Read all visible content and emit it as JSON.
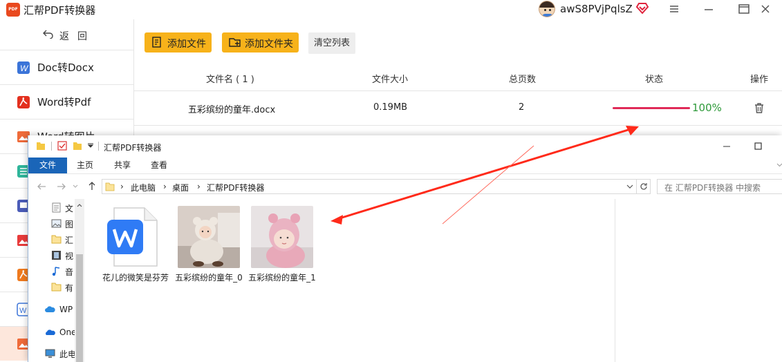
{
  "app": {
    "title": "汇帮PDF转换器",
    "logo_text": "PDF",
    "username": "awS8PVjPqlsZ",
    "accent_color": "#f7b21a",
    "progress_color": "#e02a58",
    "status_color": "#2e9a3a"
  },
  "sidebar": {
    "back_label": "返回",
    "items": [
      {
        "label": "Doc转Docx",
        "icon": "word-icon"
      },
      {
        "label": "Word转Pdf",
        "icon": "pdf-icon"
      },
      {
        "label": "Word转图片",
        "icon": "image-icon"
      },
      {
        "label": "",
        "icon": "excel-icon"
      },
      {
        "label": "",
        "icon": "ppt-icon"
      },
      {
        "label": "",
        "icon": "image-icon"
      },
      {
        "label": "",
        "icon": "pdf-icon"
      },
      {
        "label": "",
        "icon": "word-icon"
      },
      {
        "label": "",
        "icon": "image-icon"
      }
    ]
  },
  "toolbar": {
    "add_file": "添加文件",
    "add_folder": "添加文件夹",
    "clear_list": "清空列表"
  },
  "table": {
    "headers": {
      "name": "文件名 ( 1 )",
      "size": "文件大小",
      "pages": "总页数",
      "status": "状态",
      "action": "操作"
    },
    "rows": [
      {
        "name": "五彩缤纷的童年.docx",
        "size": "0.19MB",
        "pages": "2",
        "progress": 1.0,
        "status": "100%"
      }
    ]
  },
  "explorer": {
    "title": "汇帮PDF转换器",
    "ribbon_tabs": [
      "文件",
      "主页",
      "共享",
      "查看"
    ],
    "breadcrumb": [
      "此电脑",
      "桌面",
      "汇帮PDF转换器"
    ],
    "search_placeholder": "在 汇帮PDF转换器 中搜索",
    "nav_items": [
      {
        "label": "文",
        "icon": "document-icon"
      },
      {
        "label": "图",
        "icon": "picture-icon"
      },
      {
        "label": "汇",
        "icon": "folder-icon"
      },
      {
        "label": "视",
        "icon": "video-icon"
      },
      {
        "label": "音",
        "icon": "music-icon"
      },
      {
        "label": "有",
        "icon": "folder-icon"
      },
      {
        "label": "WP",
        "icon": "cloud-icon"
      },
      {
        "label": "One",
        "icon": "onedrive-icon"
      },
      {
        "label": "此电",
        "icon": "computer-icon"
      }
    ],
    "files": [
      {
        "name": "花儿的微笑是芬芳",
        "type": "wps-doc"
      },
      {
        "name": "五彩缤纷的童年_0",
        "type": "photo"
      },
      {
        "name": "五彩缤纷的童年_1",
        "type": "photo"
      }
    ]
  }
}
